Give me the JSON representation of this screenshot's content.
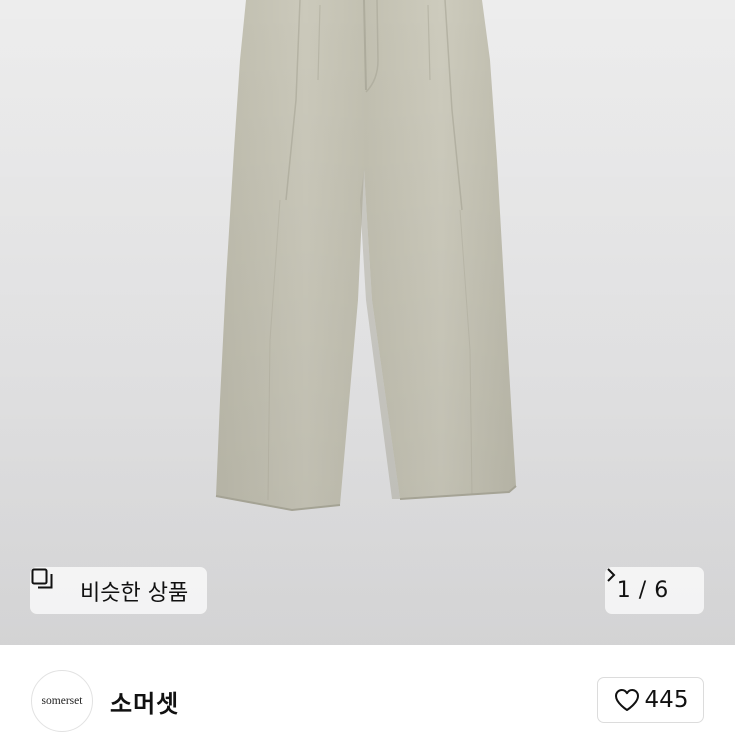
{
  "gallery": {
    "image_alt": "beige pleated wide trousers",
    "current_page": "1",
    "separator": "/",
    "total_pages": "6",
    "similar_label": "비슷한 상품",
    "similar_icon": "copy-icon",
    "next_icon": "chevron-right-icon"
  },
  "seller": {
    "avatar_text": "somerset",
    "name": "소머셋"
  },
  "like": {
    "icon": "heart-icon",
    "count": "445"
  },
  "colors": {
    "pants": "#c8c6b8",
    "background": "#ebebeb"
  }
}
